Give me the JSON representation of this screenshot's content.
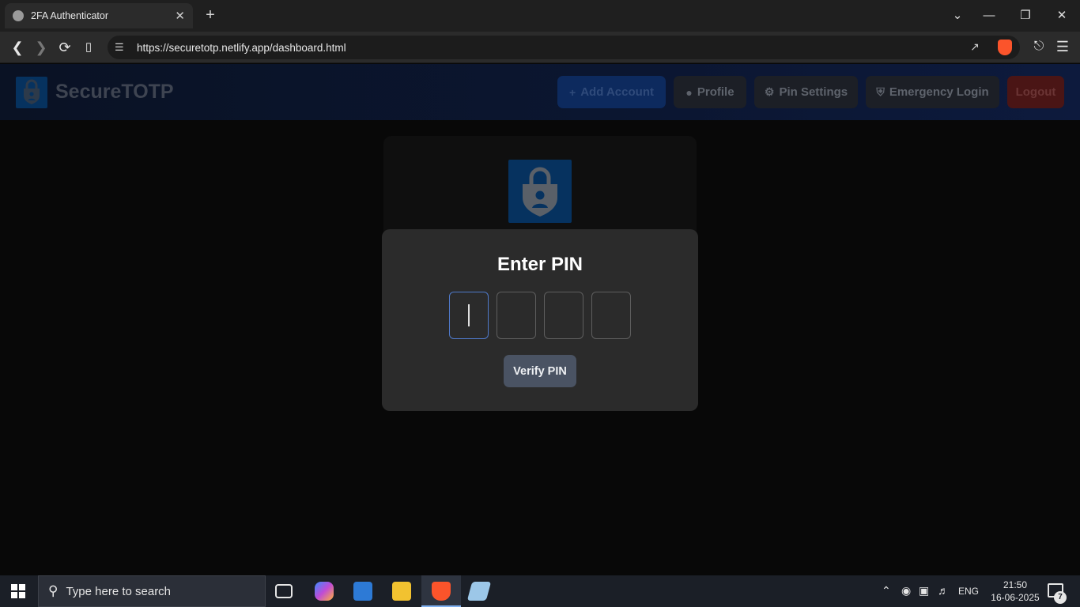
{
  "browser": {
    "tab_title": "2FA Authenticator",
    "tab_close": "✕",
    "new_tab": "+",
    "url": "https://securetotp.netlify.app/dashboard.html",
    "win_minimize": "—",
    "win_restore": "❐",
    "win_close": "✕",
    "tab_list": "⌄"
  },
  "header": {
    "app_name": "SecureTOTP",
    "buttons": {
      "add_account": "Add Account",
      "profile": "Profile",
      "pin_settings": "Pin Settings",
      "emergency_login": "Emergency Login",
      "logout": "Logout"
    },
    "button_colors": {
      "add_account": "#0d2a5e",
      "profile": "#1c1f26",
      "pin_settings": "#1c1f26",
      "emergency_login": "#1c1f26",
      "logout": "#4a1515"
    }
  },
  "pin_modal": {
    "title": "Enter PIN",
    "digits": [
      "",
      "",
      "",
      ""
    ],
    "verify_label": "Verify PIN"
  },
  "taskbar": {
    "search_placeholder": "Type here to search",
    "language": "ENG",
    "time": "21:50",
    "date": "16-06-2025",
    "notification_count": "7"
  }
}
